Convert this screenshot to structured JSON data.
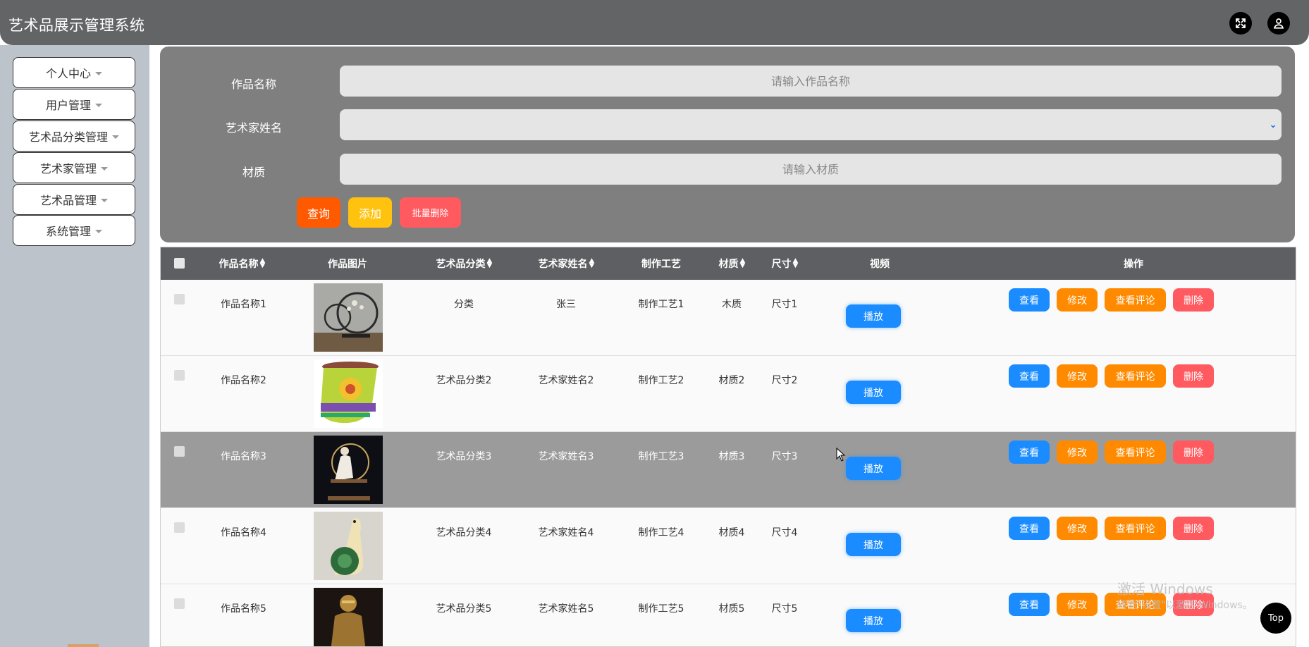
{
  "header": {
    "title": "艺术品展示管理系统",
    "fullscreen_icon": "fullscreen-icon",
    "user_icon": "user-icon"
  },
  "sidebar": {
    "items": [
      {
        "label": "个人中心"
      },
      {
        "label": "用户管理"
      },
      {
        "label": "艺术品分类管理"
      },
      {
        "label": "艺术家管理"
      },
      {
        "label": "艺术品管理"
      },
      {
        "label": "系统管理"
      }
    ]
  },
  "search": {
    "name_label": "作品名称",
    "name_placeholder": "请输入作品名称",
    "artist_label": "艺术家姓名",
    "artist_value": "",
    "material_label": "材质",
    "material_placeholder": "请输入材质",
    "query_label": "查询",
    "add_label": "添加",
    "batch_delete_label": "批量删除"
  },
  "colors": {
    "query": "#ff5a00",
    "add": "#ffc20e",
    "batch_delete": "#ff5a5f",
    "view": "#1a8cff",
    "edit": "#ff8a00",
    "comments": "#ff8a00",
    "delete": "#ff5a5f",
    "play": "#1a8cff"
  },
  "table": {
    "headers": {
      "name": "作品名称",
      "image": "作品图片",
      "category": "艺术品分类",
      "artist": "艺术家姓名",
      "craft": "制作工艺",
      "material": "材质",
      "size": "尺寸",
      "video": "视频",
      "actions": "操作"
    },
    "buttons": {
      "play": "播放",
      "view": "查看",
      "edit": "修改",
      "comments": "查看评论",
      "delete": "删除"
    },
    "rows": [
      {
        "name": "作品名称1",
        "category": "分类",
        "artist": "张三",
        "craft": "制作工艺1",
        "material": "木质",
        "size": "尺寸1"
      },
      {
        "name": "作品名称2",
        "category": "艺术品分类2",
        "artist": "艺术家姓名2",
        "craft": "制作工艺2",
        "material": "材质2",
        "size": "尺寸2"
      },
      {
        "name": "作品名称3",
        "category": "艺术品分类3",
        "artist": "艺术家姓名3",
        "craft": "制作工艺3",
        "material": "材质3",
        "size": "尺寸3"
      },
      {
        "name": "作品名称4",
        "category": "艺术品分类4",
        "artist": "艺术家姓名4",
        "craft": "制作工艺4",
        "material": "材质4",
        "size": "尺寸4"
      },
      {
        "name": "作品名称5",
        "category": "艺术品分类5",
        "artist": "艺术家姓名5",
        "craft": "制作工艺5",
        "material": "材质5",
        "size": "尺寸5"
      }
    ]
  },
  "watermark": {
    "line1": "激活 Windows",
    "line2": "转到\"设置\"以激活 Windows。"
  },
  "top_button": "Top"
}
